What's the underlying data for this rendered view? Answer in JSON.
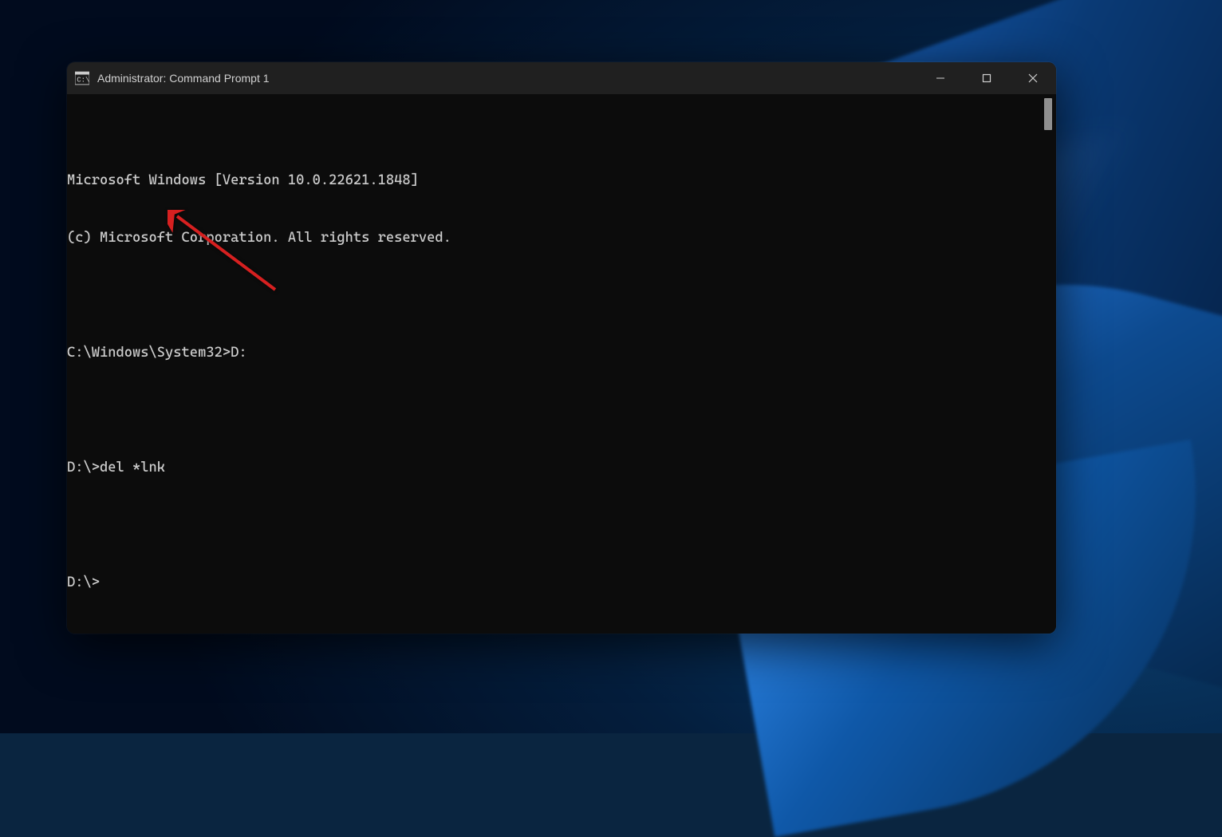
{
  "window": {
    "title": "Administrator: Command Prompt 1"
  },
  "terminal": {
    "line1": "Microsoft Windows [Version 10.0.22621.1848]",
    "line2": "(c) Microsoft Corporation. All rights reserved.",
    "line3_prompt": "C:\\Windows\\System32>",
    "line3_cmd": "D:",
    "line4_prompt": "D:\\>",
    "line4_cmd": "del *lnk",
    "line5_prompt": "D:\\>"
  },
  "annotation": {
    "arrow_color": "#d62020"
  }
}
